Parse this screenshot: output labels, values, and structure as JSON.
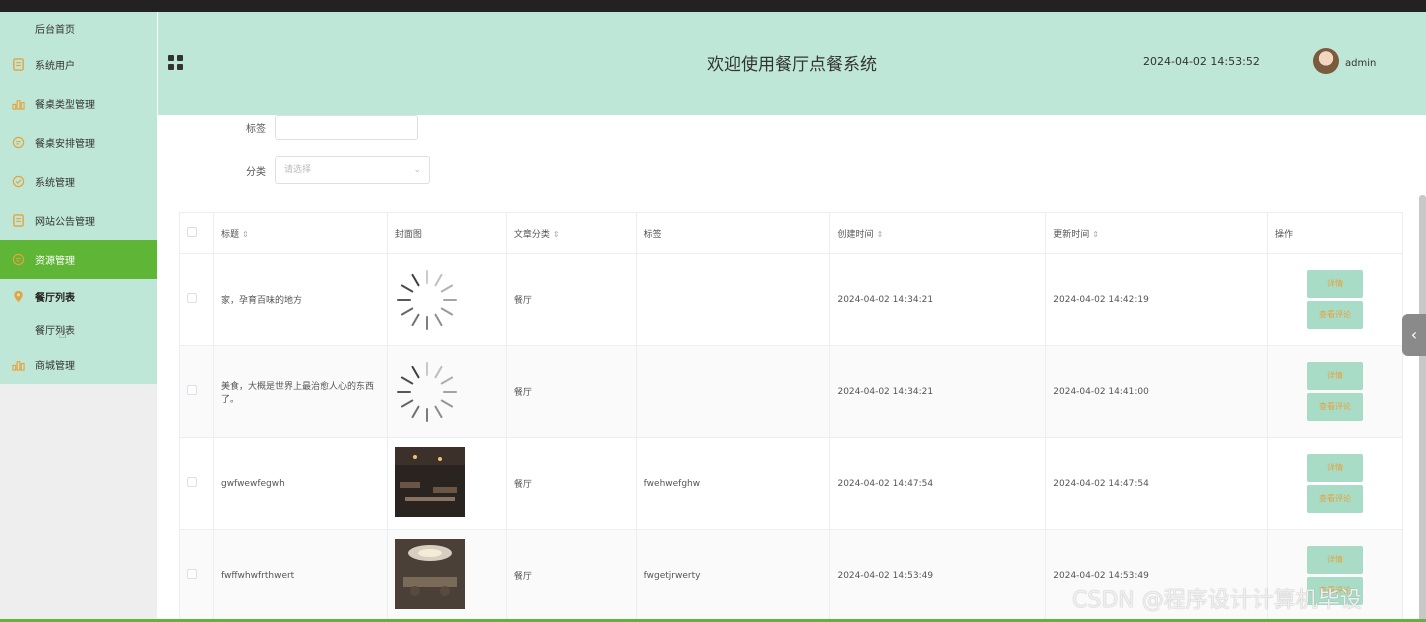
{
  "sidebar": {
    "items": [
      {
        "label": "后台首页",
        "icon": "none"
      },
      {
        "label": "系统用户",
        "icon": "document-icon"
      },
      {
        "label": "餐桌类型管理",
        "icon": "bar-chart-icon"
      },
      {
        "label": "餐桌安排管理",
        "icon": "chat-icon"
      },
      {
        "label": "系统管理",
        "icon": "check-circle-icon"
      },
      {
        "label": "网站公告管理",
        "icon": "document-icon"
      },
      {
        "label": "资源管理",
        "icon": "chat-icon"
      },
      {
        "label": "餐厅列表",
        "icon": "location-pin-icon"
      },
      {
        "label": "餐厅列表",
        "icon": "none"
      },
      {
        "label": "商城管理",
        "icon": "bar-chart-icon"
      }
    ]
  },
  "header": {
    "title": "欢迎使用餐厅点餐系统",
    "datetime": "2024-04-02 14:53:52",
    "username": "admin"
  },
  "filters": {
    "tag_label": "标签",
    "category_label": "分类",
    "category_placeholder": "请选择"
  },
  "table": {
    "columns": [
      "标题",
      "封面图",
      "文章分类",
      "标签",
      "创建时间",
      "更新时间",
      "操作"
    ],
    "rows": [
      {
        "title": "家，孕育百味的地方",
        "cover": "loading",
        "category": "餐厅",
        "tag": "",
        "created": "2024-04-02 14:34:21",
        "updated": "2024-04-02 14:42:19"
      },
      {
        "title": "美食，大概是世界上最治愈人心的东西了。",
        "cover": "loading",
        "category": "餐厅",
        "tag": "",
        "created": "2024-04-02 14:34:21",
        "updated": "2024-04-02 14:41:00"
      },
      {
        "title": "gwfwewfegwh",
        "cover": "image",
        "category": "餐厅",
        "tag": "fwehwefghw",
        "created": "2024-04-02 14:47:54",
        "updated": "2024-04-02 14:47:54"
      },
      {
        "title": "fwffwhwfrthwert",
        "cover": "image",
        "category": "餐厅",
        "tag": "fwgetjrwerty",
        "created": "2024-04-02 14:53:49",
        "updated": "2024-04-02 14:53:49"
      }
    ],
    "btn_detail": "详情",
    "btn_comment": "查看评论"
  },
  "watermark": "CSDN @程序设计计算机毕设",
  "colors": {
    "menu_bg": "#bfe7d7",
    "active": "#5fb536",
    "button": "#a8dcc6",
    "button_text": "#e6a23c"
  }
}
